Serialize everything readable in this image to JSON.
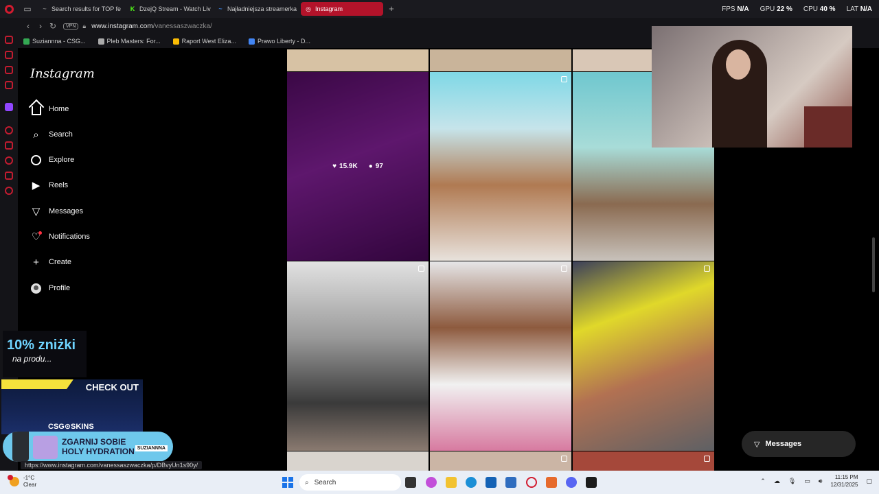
{
  "browser": {
    "tabs": [
      {
        "title": "Search results for TOP fe",
        "fav_color": "#7a7a7a",
        "fav_glyph": "~"
      },
      {
        "title": "DzejQ Stream - Watch Liv",
        "fav_color": "#53fc18",
        "fav_glyph": "K"
      },
      {
        "title": "Najładniejsza streamerka",
        "fav_color": "#3a7bd5",
        "fav_glyph": "~"
      },
      {
        "title": "Instagram",
        "fav_color": "#e1306c",
        "fav_glyph": "◎"
      }
    ],
    "new_tab_glyph": "+",
    "perf": [
      {
        "label": "FPS",
        "value": "N/A"
      },
      {
        "label": "GPU",
        "value": "22 %"
      },
      {
        "label": "CPU",
        "value": "40 %"
      },
      {
        "label": "LAT",
        "value": "N/A"
      }
    ],
    "vpn_label": "VPN",
    "url_host": "www.instagram.com",
    "url_path": "/vanessaszwaczka/",
    "bookmarks": [
      {
        "label": "Suziannna - CSG...",
        "color": "#34a853"
      },
      {
        "label": "Pleb Masters: For...",
        "color": "#aaaaaa"
      },
      {
        "label": "Raport West Eliza...",
        "color": "#fbbc04"
      },
      {
        "label": "Prawo Liberty - D...",
        "color": "#4285f4"
      }
    ],
    "status_url": "https://www.instagram.com/vanessaszwaczka/p/DBvyUn1s90y/"
  },
  "instagram": {
    "logo": "Instagram",
    "nav": [
      {
        "label": "Home",
        "icon": "home-icon"
      },
      {
        "label": "Search",
        "icon": "search-icon"
      },
      {
        "label": "Explore",
        "icon": "compass-icon"
      },
      {
        "label": "Reels",
        "icon": "reels-icon"
      },
      {
        "label": "Messages",
        "icon": "messenger-icon"
      },
      {
        "label": "Notifications",
        "icon": "heart-icon"
      },
      {
        "label": "Create",
        "icon": "plus-icon"
      },
      {
        "label": "Profile",
        "icon": "avatar-icon"
      }
    ],
    "hover_post": {
      "likes": "15.9K",
      "comments": "97"
    },
    "messages_pill": "Messages"
  },
  "ads": {
    "discount_big": "10% zniżki",
    "discount_small": "na produ...",
    "check_out": "CHECK OUT",
    "csgo": "CSG⊙SKINS",
    "holy_line1": "ZGARNIJ SOBIE",
    "holy_line2": "HOLY HYDRATION",
    "holy_badge": "SUZIANNNA"
  },
  "taskbar": {
    "temp": "-1°C",
    "condition": "Clear",
    "search_placeholder": "Search",
    "time": "11:15 PM",
    "date": "12/31/2025"
  }
}
